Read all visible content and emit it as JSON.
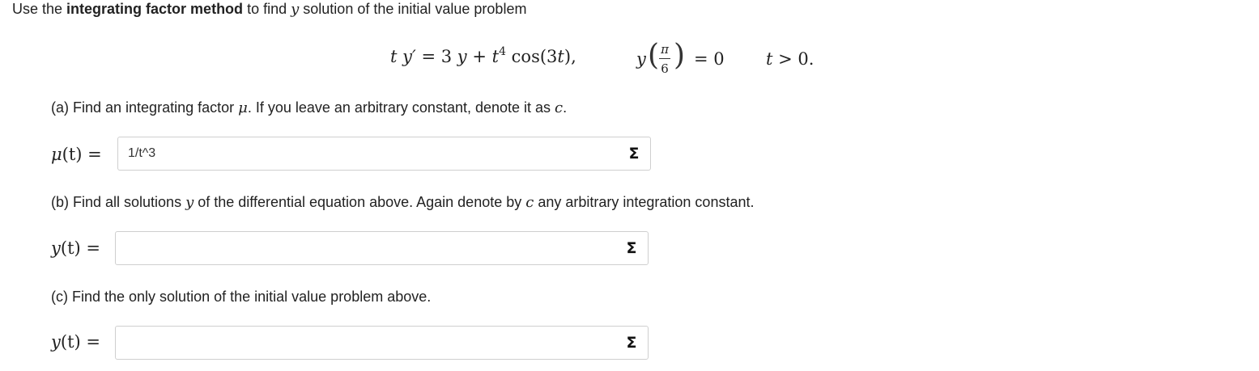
{
  "intro": {
    "prefix": "Use the ",
    "bold": "integrating factor method",
    "mid": " to find ",
    "var": "y",
    "suffix": " solution of the initial value problem"
  },
  "equation": {
    "lhs_t": "t",
    "lhs_y": "y′",
    "eq": " = 3",
    "y": "y",
    "plus": "+ ",
    "t": "t",
    "exp": "4",
    "cos": " cos(3",
    "cos_t": "t",
    "cos_end": "),",
    "ic_y": "y",
    "ic_num": "π",
    "ic_den": "6",
    "ic_open": "(",
    "ic_close": ")",
    "ic_eq": "= 0",
    "cond_t": "t",
    "cond": " > 0."
  },
  "part_a": {
    "text_before": "(a) Find an integrating factor ",
    "mu": "μ",
    "text_after": ". If you leave an arbitrary constant, denote it as ",
    "c": "c",
    "period": ".",
    "label_mu": "μ",
    "label_rest": "(t) =",
    "value": "1/t^3"
  },
  "part_b": {
    "text_before": "(b) Find all solutions ",
    "y": "y",
    "text_mid": " of the differential equation above. Again denote by ",
    "c": "c",
    "text_after": " any arbitrary integration constant.",
    "label_y": "y",
    "label_rest": "(t) =",
    "value": ""
  },
  "part_c": {
    "text": "(c) Find the only solution of the initial value problem above.",
    "label_y": "y",
    "label_rest": "(t) =",
    "value": ""
  },
  "sigma_symbol": "Σ"
}
